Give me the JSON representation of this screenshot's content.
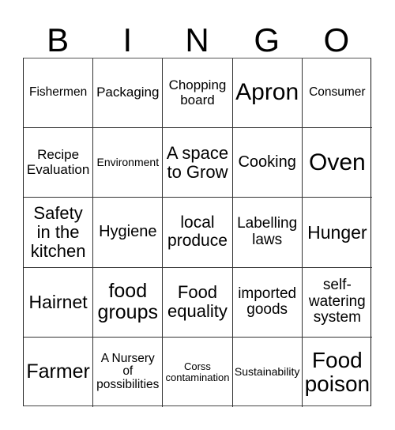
{
  "header": {
    "letters": [
      "B",
      "I",
      "N",
      "G",
      "O"
    ]
  },
  "card": {
    "rows": [
      [
        "Fishermen",
        "Packaging",
        "Chopping board",
        "Apron",
        "Consumer"
      ],
      [
        "Recipe Evaluation",
        "Environment",
        "A space to Grow",
        "Cooking",
        "Oven"
      ],
      [
        "Safety in the kitchen",
        "Hygiene",
        "local produce",
        "Labelling laws",
        "Hunger"
      ],
      [
        "Hairnet",
        "food groups",
        "Food equality",
        "imported goods",
        "self-watering system"
      ],
      [
        "Farmer",
        "A Nursery of possibilities",
        "Corss contamination",
        "Sustainability",
        "Food poison"
      ]
    ]
  }
}
